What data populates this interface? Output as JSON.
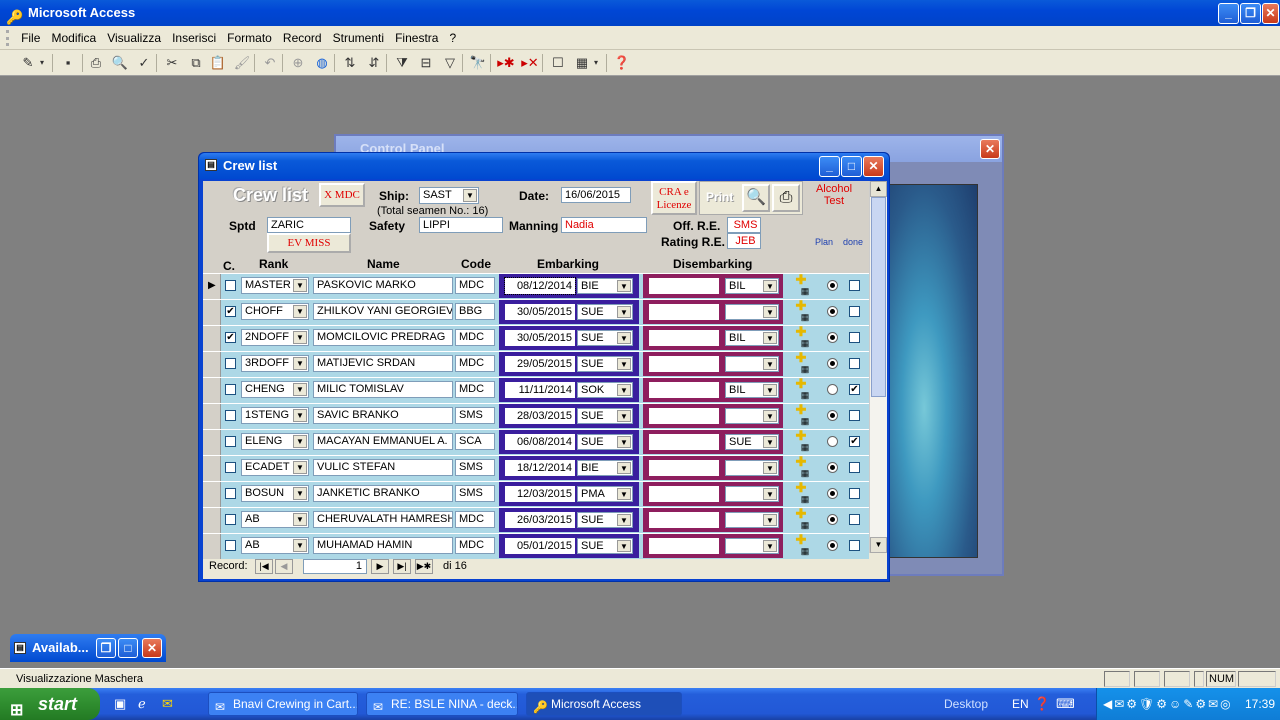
{
  "app": {
    "title": "Microsoft Access"
  },
  "menu": [
    "File",
    "Modifica",
    "Visualizza",
    "Inserisci",
    "Formato",
    "Record",
    "Strumenti",
    "Finestra",
    "?"
  ],
  "control_panel": {
    "title": "Control Panel"
  },
  "crew_window": {
    "title": "Crew list",
    "heading": "Crew list",
    "x_mdc_button": "X MDC",
    "ship_label": "Ship:",
    "ship_value": "SAST",
    "total_seamen": "(Total seamen No.: 16)",
    "date_label": "Date:",
    "date_value": "16/06/2015",
    "cra_button_line1": "CRA e",
    "cra_button_line2": "Licenze",
    "print_label": "Print",
    "alcohol_label_1": "Alcohol",
    "alcohol_label_2": "Test",
    "sptd_label": "Sptd",
    "sptd_value": "ZARIC",
    "ev_miss_button": "EV MISS",
    "safety_label": "Safety",
    "safety_value": "LIPPI",
    "manning_label": "Manning",
    "manning_value": "Nadia",
    "off_re_label": "Off. R.E.",
    "off_re_value": "SMS",
    "rating_re_label": "Rating R.E.",
    "rating_re_value": "JEB",
    "plan_label": "Plan",
    "done_label": "done",
    "columns": {
      "c": "C.",
      "rank": "Rank",
      "name": "Name",
      "code": "Code",
      "embarking": "Embarking",
      "disembarking": "Disembarking"
    },
    "rows": [
      {
        "checked": false,
        "rank": "MASTER",
        "name": "PASKOVIC MARKO",
        "code": "MDC",
        "emb_date": "08/12/2014",
        "emb_port": "BIE",
        "dis_date": "",
        "dis_port": "BIL",
        "plan": true,
        "done": false
      },
      {
        "checked": true,
        "rank": "CHOFF",
        "name": "ZHILKOV YANI GEORGIEV",
        "code": "BBG",
        "emb_date": "30/05/2015",
        "emb_port": "SUE",
        "dis_date": "",
        "dis_port": "",
        "plan": true,
        "done": false
      },
      {
        "checked": true,
        "rank": "2NDOFF",
        "name": "MOMCILOVIC PREDRAG",
        "code": "MDC",
        "emb_date": "30/05/2015",
        "emb_port": "SUE",
        "dis_date": "",
        "dis_port": "BIL",
        "plan": true,
        "done": false
      },
      {
        "checked": false,
        "rank": "3RDOFF",
        "name": "MATIJEVIC SRDAN",
        "code": "MDC",
        "emb_date": "29/05/2015",
        "emb_port": "SUE",
        "dis_date": "",
        "dis_port": "",
        "plan": true,
        "done": false
      },
      {
        "checked": false,
        "rank": "CHENG",
        "name": "MILIC TOMISLAV",
        "code": "MDC",
        "emb_date": "11/11/2014",
        "emb_port": "SOK",
        "dis_date": "",
        "dis_port": "BIL",
        "plan": false,
        "done": true
      },
      {
        "checked": false,
        "rank": "1STENG",
        "name": "SAVIC BRANKO",
        "code": "SMS",
        "emb_date": "28/03/2015",
        "emb_port": "SUE",
        "dis_date": "",
        "dis_port": "",
        "plan": true,
        "done": false
      },
      {
        "checked": false,
        "rank": "ELENG",
        "name": "MACAYAN EMMANUEL A.",
        "code": "SCA",
        "emb_date": "06/08/2014",
        "emb_port": "SUE",
        "dis_date": "",
        "dis_port": "SUE",
        "plan": false,
        "done": true
      },
      {
        "checked": false,
        "rank": "ECADET",
        "name": "VULIC STEFAN",
        "code": "SMS",
        "emb_date": "18/12/2014",
        "emb_port": "BIE",
        "dis_date": "",
        "dis_port": "",
        "plan": true,
        "done": false
      },
      {
        "checked": false,
        "rank": "BOSUN",
        "name": "JANKETIC BRANKO",
        "code": "SMS",
        "emb_date": "12/03/2015",
        "emb_port": "PMA",
        "dis_date": "",
        "dis_port": "",
        "plan": true,
        "done": false
      },
      {
        "checked": false,
        "rank": "AB",
        "name": "CHERUVALATH HAMRESH",
        "code": "MDC",
        "emb_date": "26/03/2015",
        "emb_port": "SUE",
        "dis_date": "",
        "dis_port": "",
        "plan": true,
        "done": false
      },
      {
        "checked": false,
        "rank": "AB",
        "name": "MUHAMAD HAMIN",
        "code": "MDC",
        "emb_date": "05/01/2015",
        "emb_port": "SUE",
        "dis_date": "",
        "dis_port": "",
        "plan": true,
        "done": false
      }
    ],
    "nav": {
      "label": "Record:",
      "current": "1",
      "of": "di 16"
    }
  },
  "avail_window": {
    "title": "Availab..."
  },
  "status": {
    "text": "Visualizzazione Maschera",
    "num": "NUM"
  },
  "taskbar": {
    "start": "start",
    "tasks": [
      {
        "label": "Bnavi Crewing in Cart..."
      },
      {
        "label": "RE: BSLE NINA - deck..."
      },
      {
        "label": "Microsoft Access"
      }
    ],
    "desktop": "Desktop",
    "lang": "EN",
    "clock": "17:39"
  }
}
